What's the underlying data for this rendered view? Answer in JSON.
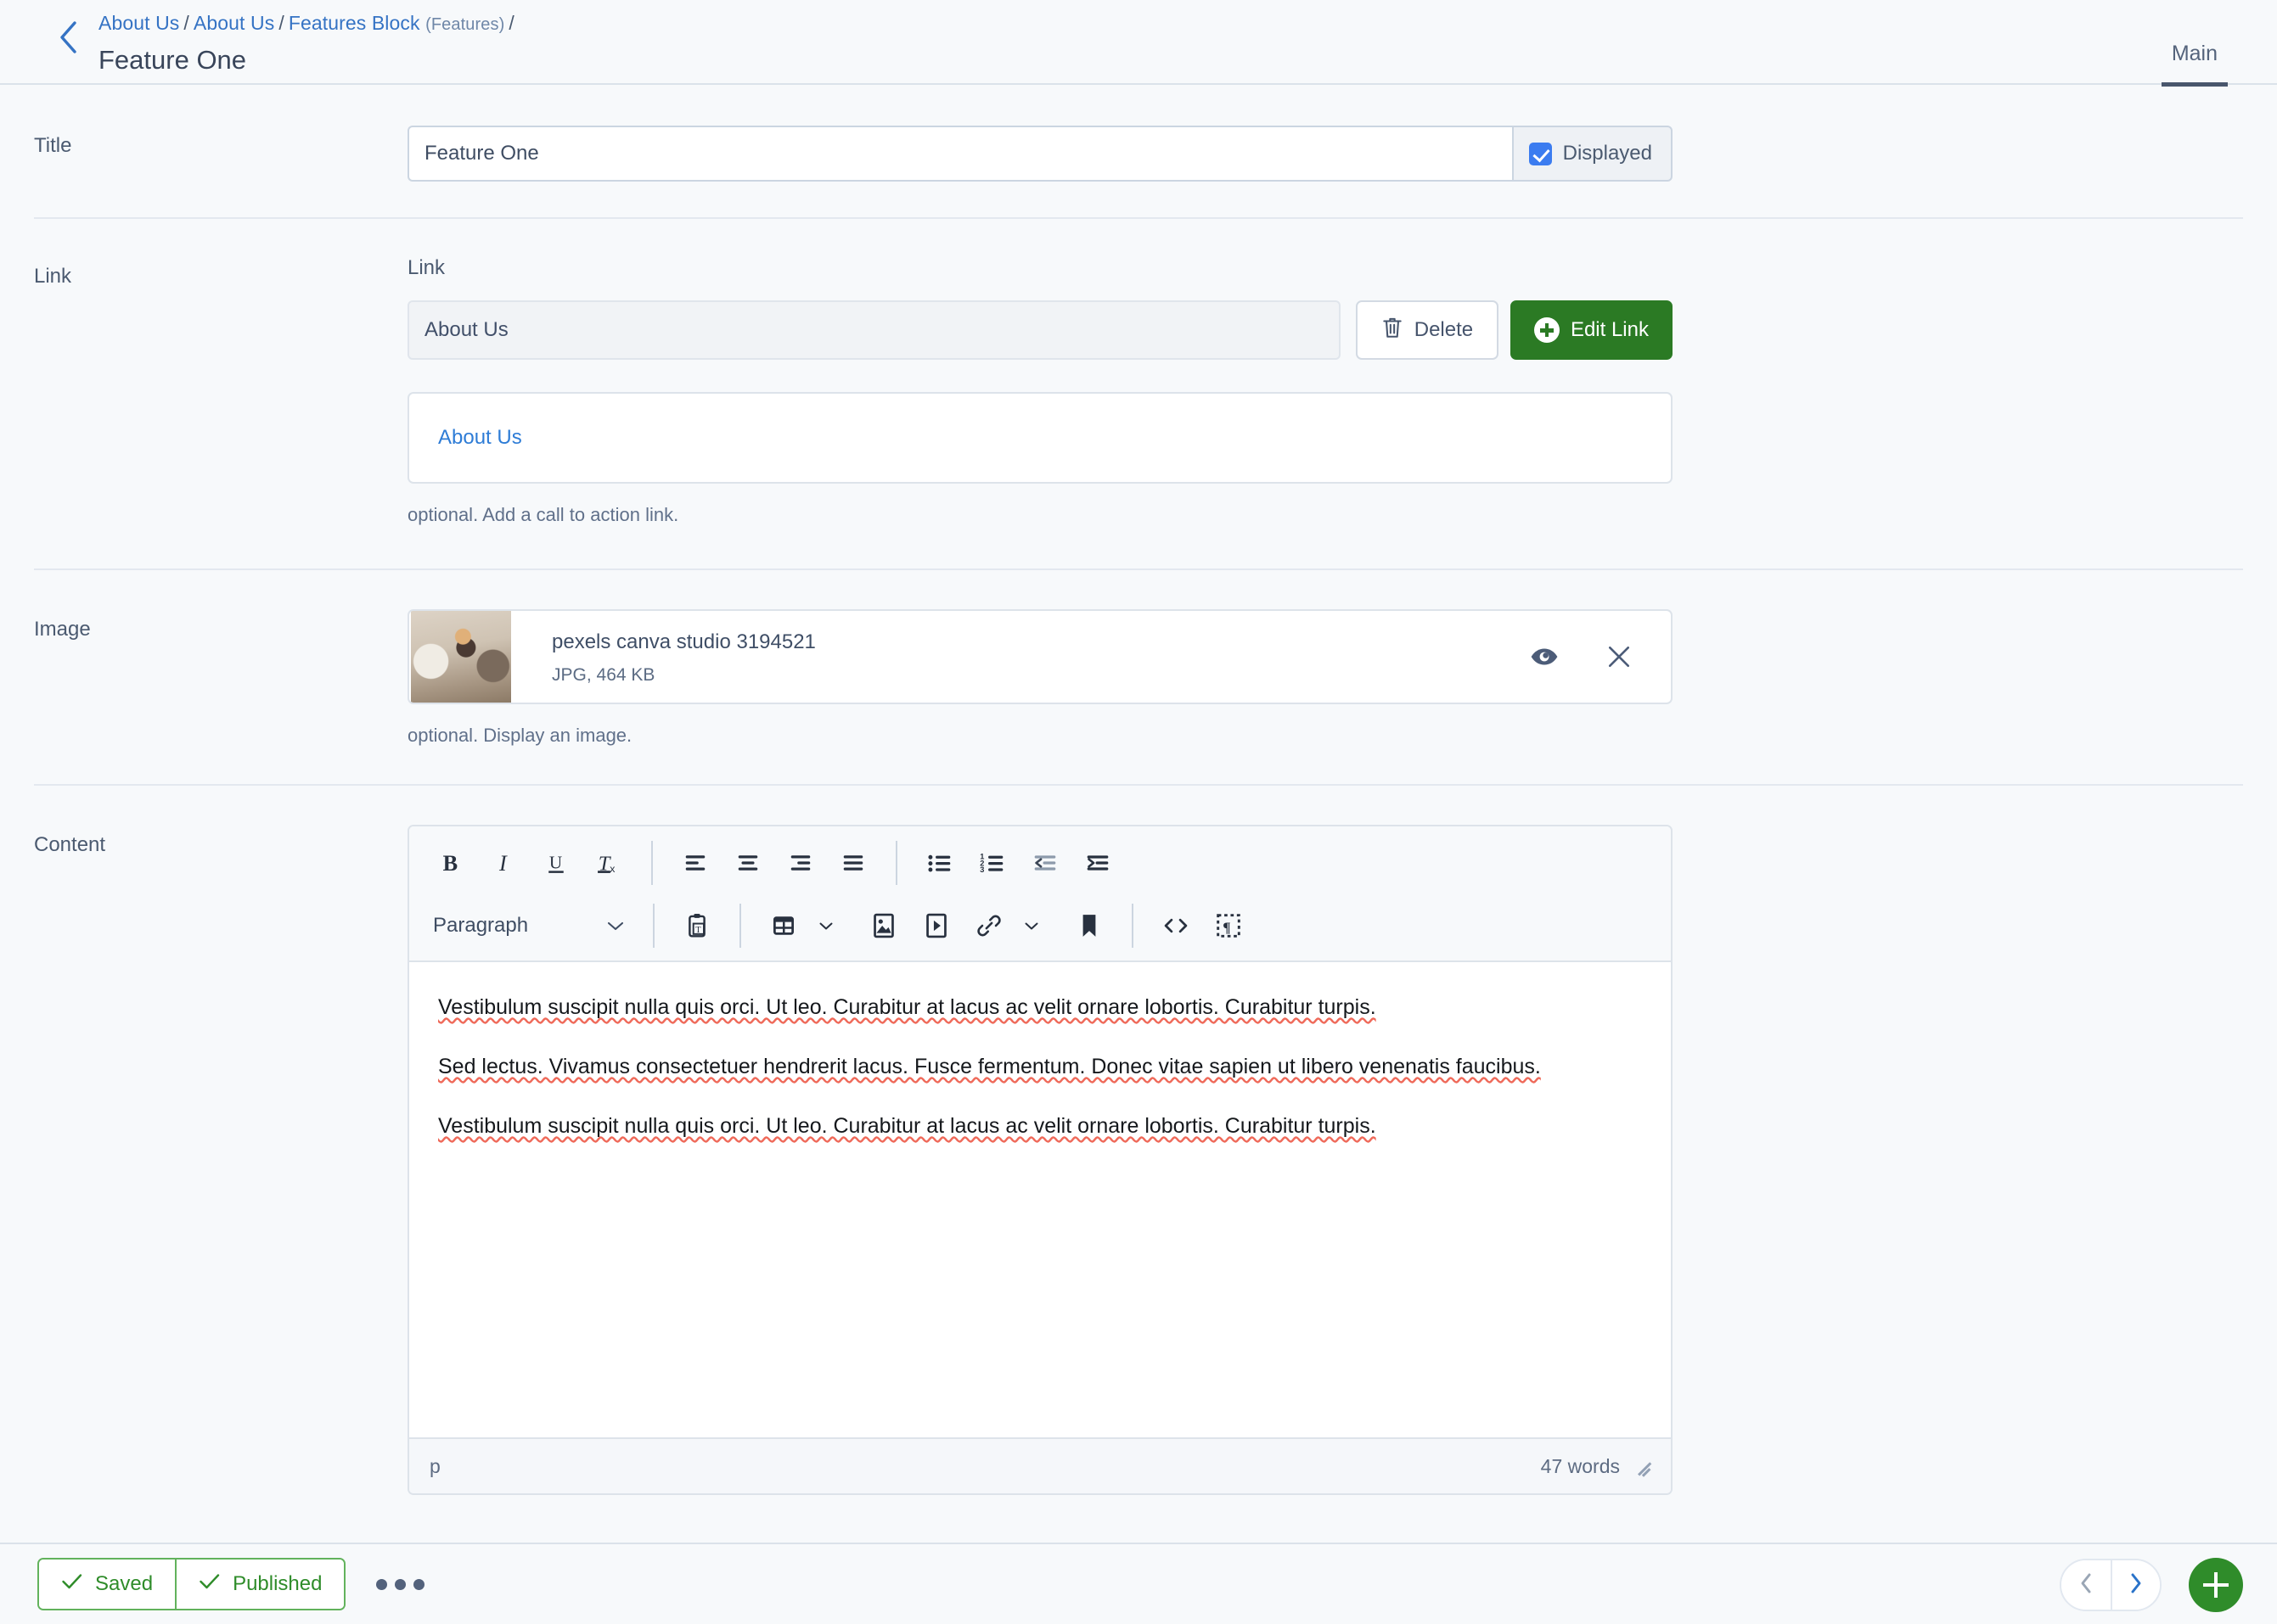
{
  "header": {
    "back_icon": "chevron-left-icon",
    "breadcrumb": [
      {
        "label": "About Us",
        "sub": ""
      },
      {
        "label": "About Us",
        "sub": ""
      },
      {
        "label": "Features Block",
        "sub": "(Features)"
      }
    ],
    "separator": "/",
    "page_title": "Feature One",
    "tabs": [
      {
        "label": "Main",
        "active": true
      }
    ]
  },
  "fields": {
    "title": {
      "label": "Title",
      "value": "Feature One",
      "placeholder": "",
      "displayed_label": "Displayed",
      "displayed_checked": true
    },
    "link": {
      "label": "Link",
      "sub_label": "Link",
      "value": "About Us",
      "delete_label": "Delete",
      "edit_label": "Edit Link",
      "preview_text": "About Us",
      "hint": "optional. Add a call to action link."
    },
    "image": {
      "label": "Image",
      "file_name": "pexels canva studio 3194521",
      "file_meta": "JPG, 464 KB",
      "hint": "optional. Display an image."
    },
    "content": {
      "label": "Content",
      "toolbar": {
        "bold": "B",
        "italic": "I",
        "underline": "U",
        "remove_format": "Tx",
        "align_left": "align-left-icon",
        "align_center": "align-center-icon",
        "align_right": "align-right-icon",
        "align_justify": "align-justify-icon",
        "bulleted_list": "bulleted-list-icon",
        "numbered_list": "numbered-list-icon",
        "outdent": "outdent-icon",
        "indent": "indent-icon",
        "paragraph_format": "Paragraph",
        "paste_text": "paste-as-text-icon",
        "table": "table-icon",
        "image": "insert-image-icon",
        "media": "insert-media-icon",
        "link": "link-icon",
        "anchor": "anchor-bookmark-icon",
        "source": "source-code-icon",
        "show_blocks": "show-blocks-icon"
      },
      "paragraphs": [
        "Vestibulum suscipit nulla quis orci. Ut leo. Curabitur at lacus ac velit ornare lobortis. Curabitur turpis.",
        "Sed lectus. Vivamus consectetuer hendrerit lacus. Fusce fermentum. Donec vitae sapien ut libero venenatis faucibus.",
        "Vestibulum suscipit nulla quis orci. Ut leo. Curabitur at lacus ac velit ornare lobortis. Curabitur turpis."
      ],
      "status_path": "p",
      "word_count": "47 words"
    }
  },
  "footer": {
    "saved_label": "Saved",
    "published_label": "Published",
    "more_icon": "ellipsis-icon",
    "prev_icon": "chevron-left-icon",
    "next_icon": "chevron-right-icon",
    "add_icon": "plus-icon"
  },
  "colors": {
    "accent_green": "#2b7a24",
    "link_blue": "#3573c4",
    "checkbox_blue": "#3b7cf0",
    "status_green": "#2f8c2a",
    "page_bg": "#f7f9fb"
  }
}
